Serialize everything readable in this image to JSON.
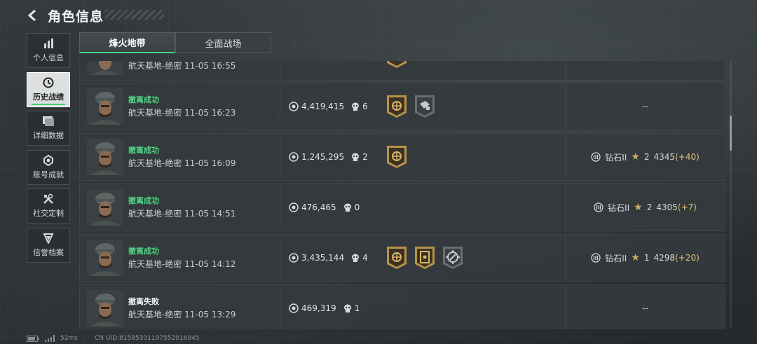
{
  "header": {
    "title": "角色信息",
    "back_icon": "chevron-left-icon"
  },
  "sidebar": {
    "items": [
      {
        "label": "个人信息",
        "icon": "bar-chart-icon",
        "active": false
      },
      {
        "label": "历史战绩",
        "icon": "clock-history-icon",
        "active": true
      },
      {
        "label": "详细数据",
        "icon": "document-stack-icon",
        "active": false
      },
      {
        "label": "账号成就",
        "icon": "achievement-icon",
        "active": false
      },
      {
        "label": "社交定制",
        "icon": "tools-icon",
        "active": false
      },
      {
        "label": "信誉档案",
        "icon": "shield-icon",
        "active": false
      }
    ]
  },
  "tabs": [
    {
      "label": "烽火地带",
      "active": true
    },
    {
      "label": "全面战场",
      "active": false
    }
  ],
  "matches": [
    {
      "status": "",
      "map_time": "航天基地-绝密 11-05 16:55",
      "value": "",
      "kills": "",
      "badges": [
        "gold"
      ],
      "rank": null
    },
    {
      "status": "撤离成功",
      "status_type": "success",
      "map_time": "航天基地-绝密 11-05 16:23",
      "value": "4,419,415",
      "kills": "6",
      "badges": [
        "gold",
        "gray"
      ],
      "rank": null,
      "rank_dash": "--"
    },
    {
      "status": "撤离成功",
      "status_type": "success",
      "map_time": "航天基地-绝密 11-05 16:09",
      "value": "1,245,295",
      "kills": "2",
      "badges": [
        "gold"
      ],
      "rank": {
        "tier": "钻石II",
        "stars": "2",
        "points": "4345",
        "change": "(+40)"
      }
    },
    {
      "status": "撤离成功",
      "status_type": "success",
      "map_time": "航天基地-绝密 11-05 14:51",
      "value": "476,465",
      "kills": "0",
      "badges": [],
      "rank": {
        "tier": "钻石II",
        "stars": "2",
        "points": "4305",
        "change": "(+7)"
      }
    },
    {
      "status": "撤离成功",
      "status_type": "success",
      "map_time": "航天基地-绝密 11-05 14:12",
      "value": "3,435,144",
      "kills": "4",
      "badges": [
        "gold",
        "gold-card",
        "gray-target"
      ],
      "rank": {
        "tier": "钻石II",
        "stars": "1",
        "points": "4298",
        "change": "(+20)"
      }
    },
    {
      "status": "撤离失败",
      "status_type": "fail",
      "map_time": "航天基地-绝密 11-05 13:29",
      "value": "469,319",
      "kills": "1",
      "badges": [],
      "rank": null,
      "rank_dash": "--"
    }
  ],
  "footer": {
    "ping": "52ms",
    "uid": "CN UID:8158533119755201​6945"
  },
  "colors": {
    "success": "#51d786",
    "accent": "#49d37a",
    "rank_gain": "#e0c27a"
  }
}
